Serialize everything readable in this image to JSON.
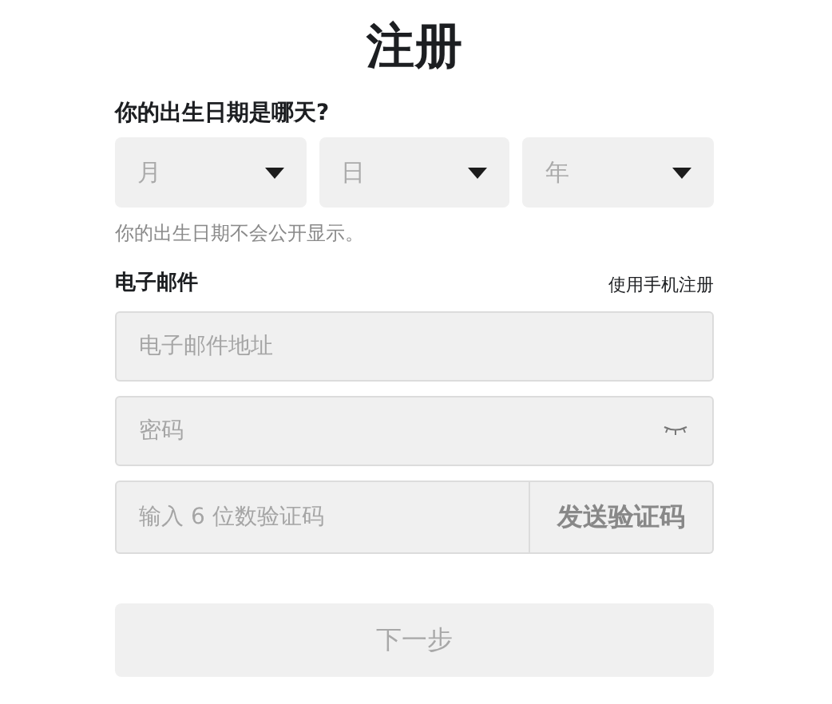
{
  "title": "注册",
  "birthday": {
    "label": "你的出生日期是哪天?",
    "selects": [
      {
        "placeholder": "月"
      },
      {
        "placeholder": "日"
      },
      {
        "placeholder": "年"
      }
    ],
    "hint": "你的出生日期不会公开显示。"
  },
  "email": {
    "label": "电子邮件",
    "switch_link": "使用手机注册",
    "placeholder": "电子邮件地址"
  },
  "password": {
    "placeholder": "密码",
    "visible": false
  },
  "code": {
    "placeholder": "输入 6 位数验证码",
    "button": "发送验证码"
  },
  "next_button": {
    "label": "下一步",
    "disabled": true
  }
}
